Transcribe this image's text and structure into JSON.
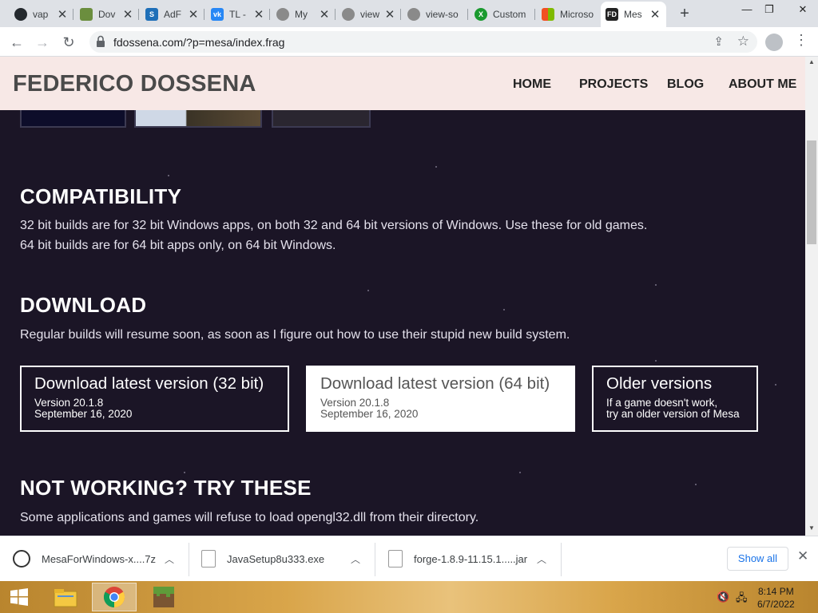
{
  "browser": {
    "tabs": [
      {
        "title": "vap",
        "icon": "github-icon",
        "color": "#24292e"
      },
      {
        "title": "Dov",
        "icon": "minecraft-icon",
        "color": "#6b8e3e"
      },
      {
        "title": "AdF",
        "icon": "adfly-icon",
        "color": "#1e6fb8"
      },
      {
        "title": "TL -",
        "icon": "vk-icon",
        "color": "#2787f5"
      },
      {
        "title": "My",
        "icon": "globe-icon",
        "color": "#8a8a8a"
      },
      {
        "title": "view",
        "icon": "globe-icon",
        "color": "#8a8a8a"
      },
      {
        "title": "view-so",
        "icon": "globe-icon",
        "color": "#8a8a8a"
      },
      {
        "title": "Custom",
        "icon": "xbox-icon",
        "color": "#1a9a2f"
      },
      {
        "title": "Microso",
        "icon": "microsoft-icon",
        "color": "#f25022"
      },
      {
        "title": "Mes",
        "icon": "fd-icon",
        "color": "#222222",
        "active": true
      }
    ],
    "url": "fdossena.com/?p=mesa/index.frag"
  },
  "site": {
    "title": "FEDERICO DOSSENA",
    "nav": [
      "HOME",
      "PROJECTS",
      "BLOG",
      "ABOUT ME"
    ]
  },
  "compatibility": {
    "heading": "COMPATIBILITY",
    "line1": "32 bit builds are for 32 bit Windows apps, on both 32 and 64 bit versions of Windows. Use these for old games.",
    "line2": "64 bit builds are for 64 bit apps only, on 64 bit Windows."
  },
  "download": {
    "heading": "DOWNLOAD",
    "note": "Regular builds will resume soon, as soon as I figure out how to use their stupid new build system.",
    "boxes": [
      {
        "title": "Download latest version (32 bit)",
        "line1": "Version 20.1.8",
        "line2": "September 16, 2020"
      },
      {
        "title": "Download latest version (64 bit)",
        "line1": "Version 20.1.8",
        "line2": "September 16, 2020"
      },
      {
        "title": "Older versions",
        "line1": "If a game doesn't work,",
        "line2": "try an older version of Mesa"
      }
    ]
  },
  "not_working": {
    "heading": "NOT WORKING? TRY THESE",
    "line1": "Some applications and games will refuse to load opengl32.dll from their directory."
  },
  "downloads_shelf": {
    "items": [
      "MesaForWindows-x....7z",
      "JavaSetup8u333.exe",
      "forge-1.8.9-11.15.1.....jar"
    ],
    "show_all": "Show all"
  },
  "taskbar": {
    "time": "8:14 PM",
    "date": "6/7/2022"
  }
}
